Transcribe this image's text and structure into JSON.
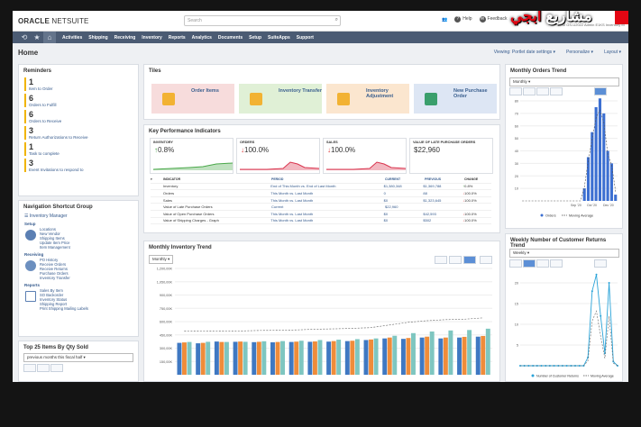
{
  "header": {
    "logo_main": "ORACLE",
    "logo_sub": " NETSUITE",
    "search_placeholder": "Search",
    "help": "Help",
    "feedback": "Feedback",
    "brand_ar_1": "مشاريع",
    "brand_ar_2": "ابجي",
    "user_line": "CRM GS-U2022  Admin E1KS  Inventory M"
  },
  "nav": {
    "items": [
      "Activities",
      "Shipping",
      "Receiving",
      "Inventory",
      "Reports",
      "Analytics",
      "Documents",
      "Setup",
      "SuiteApps",
      "Support"
    ]
  },
  "page": {
    "title": "Home",
    "viewing": "Viewing: Portlet date settings",
    "personalize": "Personalize",
    "layout": "Layout"
  },
  "reminders": {
    "title": "Reminders",
    "items": [
      {
        "num": "1",
        "label": "Item to Order"
      },
      {
        "num": "6",
        "label": "Orders to Fulfill"
      },
      {
        "num": "6",
        "label": "Orders to Receive"
      },
      {
        "num": "3",
        "label": "Return Authorizations to Receive"
      },
      {
        "num": "1",
        "label": "Task to complete"
      },
      {
        "num": "3",
        "label": "Event Invitations to respond to"
      }
    ]
  },
  "navgroup": {
    "title": "Navigation Shortcut Group",
    "group": "Inventory Manager",
    "setup": {
      "label": "Setup",
      "links": [
        "Locations",
        "New Vendor",
        "Shipping Items",
        "Update Item Price",
        "Item Management"
      ]
    },
    "receiving": {
      "label": "Receiving",
      "links": [
        "PO History",
        "Receive Orders",
        "Receive Returns",
        "Purchase Orders",
        "Inventory Transfer"
      ]
    },
    "reports": {
      "label": "Reports",
      "links": [
        "Sales By Item",
        "SO Backorder",
        "Inventory Status",
        "Shipping Report",
        "Print Shipping Mailing Labels"
      ]
    }
  },
  "top25": {
    "title": "Top 25 Items By Qty Sold",
    "period": "previous months this fiscal half"
  },
  "tiles": {
    "title": "Tiles",
    "items": [
      "Order Items",
      "Inventory Transfer",
      "Inventory Adjustment",
      "New Purchase Order"
    ],
    "colors": [
      "#f7dcdc",
      "#e0f0d6",
      "#fbe6cf",
      "#dde6f4"
    ]
  },
  "kpi": {
    "title": "Key Performance Indicators",
    "cards": [
      {
        "label": "INVENTORY",
        "value": "0.8%",
        "dir": "up"
      },
      {
        "label": "ORDERS",
        "value": "100.0%",
        "dir": "down"
      },
      {
        "label": "SALES",
        "value": "100.0%",
        "dir": "down"
      },
      {
        "label": "VALUE OF LATE PURCHASE ORDERS",
        "value": "$22,960",
        "dir": "none"
      }
    ],
    "table_headers": [
      "INDICATOR",
      "PERIOD",
      "CURRENT",
      "PREVIOUS",
      "CHANGE"
    ],
    "rows": [
      [
        "Inventory",
        "End of This Month vs. End of Last Month",
        "$1,380,348",
        "$1,369,788",
        "0.8%"
      ],
      [
        "Orders",
        "This Month vs. Last Month",
        "0",
        "88",
        "100.0%"
      ],
      [
        "Sales",
        "This Month vs. Last Month",
        "$0",
        "$1,323,645",
        "100.0%"
      ],
      [
        "Value of Late Purchase Orders",
        "Current",
        "$22,960",
        "",
        ""
      ],
      [
        "Value of Open Purchase Orders",
        "This Month vs. Last Month",
        "$0",
        "$42,593",
        "100.0%"
      ],
      [
        "Value of Shipping Charges - Graph",
        "This Month vs. Last Month",
        "$0",
        "$502",
        "100.0%"
      ]
    ]
  },
  "inv_trend": {
    "title": "Monthly Inventory Trend",
    "period": "Monthly",
    "yticks": [
      "1,200,00K",
      "1,050,00K",
      "900,00K",
      "750,00K",
      "600,00K",
      "450,00K",
      "300,00K",
      "150,00K"
    ]
  },
  "orders_trend": {
    "title": "Monthly Orders Trend",
    "period": "Monthly",
    "legend": [
      "Orders",
      "Moving Average"
    ],
    "xticks": [
      "Sep '20",
      "Oct '20",
      "Dec '20"
    ],
    "yticks": [
      "80",
      "70",
      "60",
      "50",
      "40",
      "30",
      "20",
      "10"
    ]
  },
  "returns_trend": {
    "title": "Weekly Number of Customer Returns Trend",
    "period": "Weekly",
    "legend": [
      "Number of Customer Returns",
      "Moving Average"
    ],
    "yticks": [
      "20",
      "15",
      "10",
      "5"
    ]
  },
  "chart_data": [
    {
      "type": "bar",
      "title": "Monthly Inventory Trend",
      "series": [
        {
          "name": "s1",
          "color": "#3f78c2",
          "values": [
            360,
            355,
            375,
            372,
            368,
            366,
            370,
            372,
            374,
            380,
            392,
            410,
            405,
            420,
            410,
            420,
            430
          ]
        },
        {
          "name": "s2",
          "color": "#ef8c3a",
          "values": [
            365,
            360,
            370,
            375,
            372,
            370,
            374,
            376,
            380,
            384,
            398,
            420,
            415,
            430,
            420,
            428,
            438
          ]
        },
        {
          "name": "s3",
          "color": "#7ec6c0",
          "values": [
            370,
            372,
            370,
            372,
            378,
            380,
            384,
            392,
            396,
            402,
            410,
            440,
            470,
            488,
            500,
            505,
            520
          ]
        }
      ],
      "ylim": [
        0,
        1200
      ]
    },
    {
      "type": "bar",
      "title": "Monthly Orders Trend",
      "values": [
        0,
        0,
        0,
        0,
        0,
        0,
        0,
        0,
        0,
        0,
        0,
        0,
        0,
        0,
        0,
        0,
        10,
        35,
        55,
        75,
        82,
        70,
        40,
        30,
        5
      ],
      "ylim": [
        0,
        80
      ]
    },
    {
      "type": "line",
      "title": "Weekly Number of Customer Returns Trend",
      "values": [
        0,
        0,
        0,
        0,
        0,
        0,
        0,
        0,
        0,
        0,
        0,
        0,
        0,
        0,
        0,
        0,
        2,
        18,
        22,
        12,
        3,
        20,
        1,
        0
      ],
      "ylim": [
        0,
        20
      ]
    }
  ]
}
